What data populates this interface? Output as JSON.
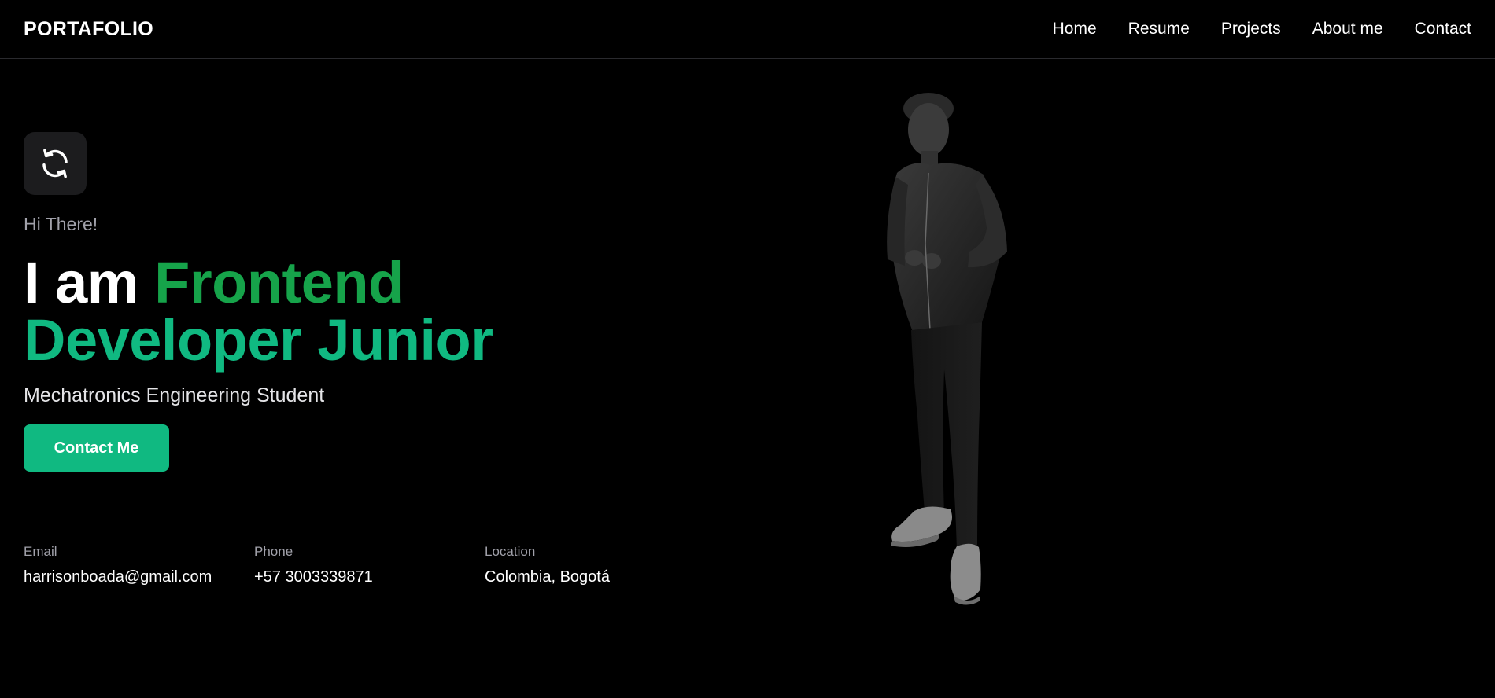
{
  "navbar": {
    "brand": "PORTAFOLIO",
    "links": [
      {
        "label": "Home"
      },
      {
        "label": "Resume"
      },
      {
        "label": "Projects"
      },
      {
        "label": "About me"
      },
      {
        "label": "Contact"
      }
    ]
  },
  "hero": {
    "icon": "refresh-icon",
    "greeting": "Hi There!",
    "headline_prefix": "I am",
    "headline_word1": "Frontend",
    "headline_line2": "Developer Junior",
    "subtitle": "Mechatronics Engineering Student",
    "cta_label": "Contact Me"
  },
  "contact": {
    "email_label": "Email",
    "email_value": "harrisonboada@gmail.com",
    "phone_label": "Phone",
    "phone_value": "+57 3003339871",
    "location_label": "Location",
    "location_value": "Colombia, Bogotá"
  },
  "colors": {
    "background": "#000000",
    "accent_green": "#16a34a",
    "accent_teal": "#10b981",
    "muted_text": "#a1a1aa"
  }
}
